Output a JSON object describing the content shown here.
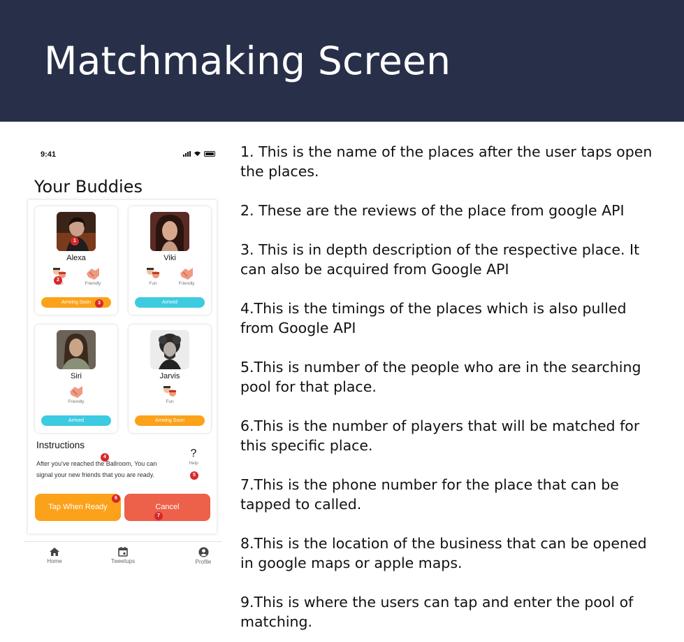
{
  "slide": {
    "title": "Matchmaking Screen"
  },
  "phone": {
    "status_time": "9:41",
    "screen_title": "Your Buddies",
    "buddies": [
      {
        "name": "Alexa",
        "tags": [
          "Fun",
          "Friendly"
        ],
        "status": "Arriving Soon",
        "status_color": "#fba21a"
      },
      {
        "name": "Viki",
        "tags": [
          "Fun",
          "Friendly"
        ],
        "status": "Arrived",
        "status_color": "#3ccbe0"
      },
      {
        "name": "Siri",
        "tags": [
          "Friendly"
        ],
        "status": "Arrived",
        "status_color": "#3ccbe0"
      },
      {
        "name": "Jarvis",
        "tags": [
          "Fun"
        ],
        "status": "Arriving Soon",
        "status_color": "#fba21a"
      }
    ],
    "instructions": {
      "title": "Instructions",
      "text": "After you've reached the Ballroom, You can signal your new friends that you are ready."
    },
    "help_label": "Help",
    "help_glyph": "?",
    "ready_button": "Tap When Ready",
    "cancel_button": "Cancel",
    "badges": [
      "1",
      "2",
      "3",
      "4",
      "5",
      "6",
      "7"
    ],
    "nav": [
      {
        "label": "Home",
        "icon": "home-icon"
      },
      {
        "label": "Tweetups",
        "icon": "calendar-icon"
      },
      {
        "label": "Profile",
        "icon": "profile-icon"
      }
    ]
  },
  "notes": [
    "1. This is the name of the places after the user taps open the places.",
    "2. These are the reviews of the place from google API",
    "3. This is in depth description of the respective place. It can also be acquired from Google API",
    "4.This is the timings of the places which is also pulled from Google API",
    "5.This is number of the people who are in the searching pool for that place.",
    "6.This is the number of players that will be matched for this specific place.",
    "7.This is the phone number for the place that can be tapped to called.",
    "8.This is the location of the business that can be opened in google maps or apple maps.",
    "9.This is where the users can tap and enter the pool of matching."
  ],
  "colors": {
    "header_bg": "#283049",
    "orange": "#fba21a",
    "cyan": "#3ccbe0",
    "cancel": "#ed6049",
    "badge": "#d8282a"
  }
}
